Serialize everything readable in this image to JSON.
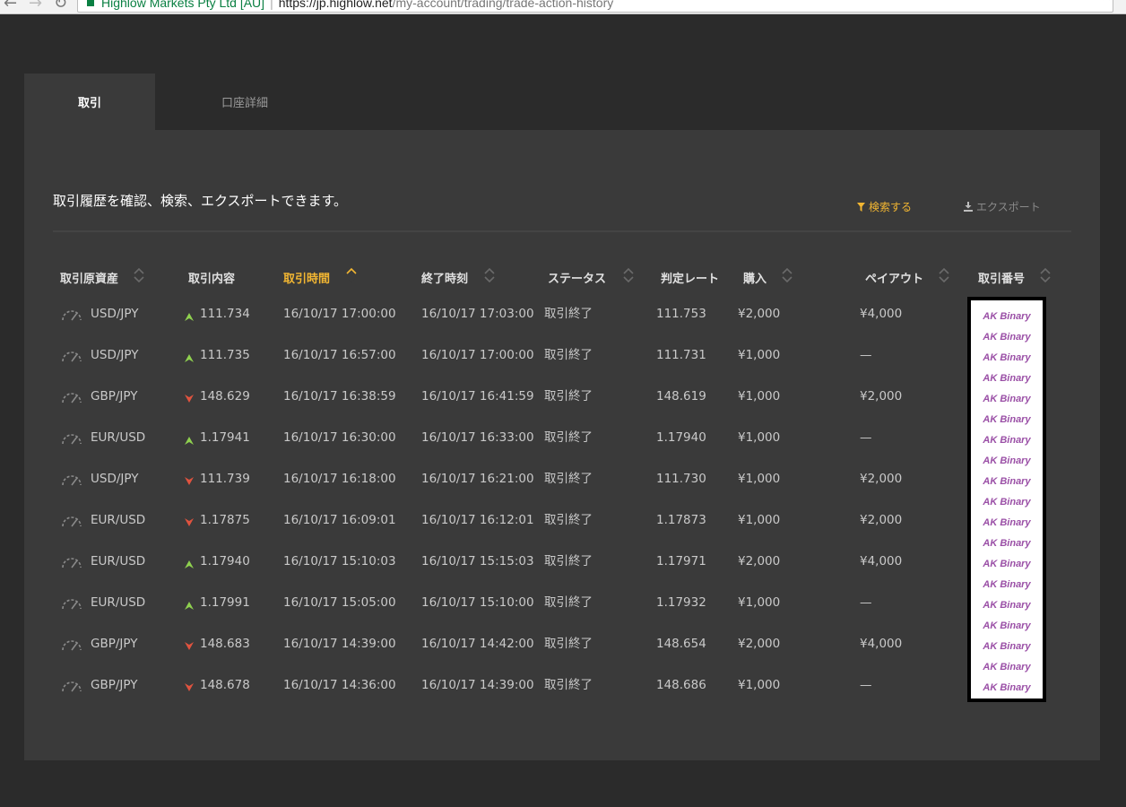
{
  "browser": {
    "site_name": "Highlow Markets Pty Ltd [AU]",
    "url_host": "https://jp.highlow.net",
    "url_path": "/my-account/trading/trade-action-history"
  },
  "tabs": [
    {
      "label": "取引",
      "active": true
    },
    {
      "label": "口座詳細",
      "active": false
    }
  ],
  "panel": {
    "description": "取引履歴を確認、検索、エクスポートできます。",
    "search_label": "検索する",
    "export_label": "エクスポート"
  },
  "table": {
    "columns": [
      "取引原資産",
      "取引内容",
      "取引時間",
      "終了時刻",
      "ステータス",
      "判定レート",
      "購入",
      "ペイアウト",
      "取引番号"
    ],
    "sorted_column": "取引時間",
    "rows": [
      {
        "asset": "USD/JPY",
        "direction": "up",
        "strike": "111.734",
        "start": "16/10/17 17:00:00",
        "end": "16/10/17 17:03:00",
        "status": "取引終了",
        "rate": "111.753",
        "amount": "¥2,000",
        "payout": "¥4,000"
      },
      {
        "asset": "USD/JPY",
        "direction": "up",
        "strike": "111.735",
        "start": "16/10/17 16:57:00",
        "end": "16/10/17 17:00:00",
        "status": "取引終了",
        "rate": "111.731",
        "amount": "¥1,000",
        "payout": "—"
      },
      {
        "asset": "GBP/JPY",
        "direction": "down",
        "strike": "148.629",
        "start": "16/10/17 16:38:59",
        "end": "16/10/17 16:41:59",
        "status": "取引終了",
        "rate": "148.619",
        "amount": "¥1,000",
        "payout": "¥2,000"
      },
      {
        "asset": "EUR/USD",
        "direction": "up",
        "strike": "1.17941",
        "start": "16/10/17 16:30:00",
        "end": "16/10/17 16:33:00",
        "status": "取引終了",
        "rate": "1.17940",
        "amount": "¥1,000",
        "payout": "—"
      },
      {
        "asset": "USD/JPY",
        "direction": "down",
        "strike": "111.739",
        "start": "16/10/17 16:18:00",
        "end": "16/10/17 16:21:00",
        "status": "取引終了",
        "rate": "111.730",
        "amount": "¥1,000",
        "payout": "¥2,000"
      },
      {
        "asset": "EUR/USD",
        "direction": "down",
        "strike": "1.17875",
        "start": "16/10/17 16:09:01",
        "end": "16/10/17 16:12:01",
        "status": "取引終了",
        "rate": "1.17873",
        "amount": "¥1,000",
        "payout": "¥2,000"
      },
      {
        "asset": "EUR/USD",
        "direction": "up",
        "strike": "1.17940",
        "start": "16/10/17 15:10:03",
        "end": "16/10/17 15:15:03",
        "status": "取引終了",
        "rate": "1.17971",
        "amount": "¥2,000",
        "payout": "¥4,000"
      },
      {
        "asset": "EUR/USD",
        "direction": "up",
        "strike": "1.17991",
        "start": "16/10/17 15:05:00",
        "end": "16/10/17 15:10:00",
        "status": "取引終了",
        "rate": "1.17932",
        "amount": "¥1,000",
        "payout": "—"
      },
      {
        "asset": "GBP/JPY",
        "direction": "down",
        "strike": "148.683",
        "start": "16/10/17 14:39:00",
        "end": "16/10/17 14:42:00",
        "status": "取引終了",
        "rate": "148.654",
        "amount": "¥2,000",
        "payout": "¥4,000"
      },
      {
        "asset": "GBP/JPY",
        "direction": "down",
        "strike": "148.678",
        "start": "16/10/17 14:36:00",
        "end": "16/10/17 14:39:00",
        "status": "取引終了",
        "rate": "148.686",
        "amount": "¥1,000",
        "payout": "—"
      }
    ]
  },
  "overlay": {
    "items": [
      "AK Binary",
      "AK Binary",
      "AK Binary",
      "AK Binary",
      "AK Binary",
      "AK Binary",
      "AK Binary",
      "AK Binary",
      "AK Binary",
      "AK Binary",
      "AK Binary",
      "AK Binary",
      "AK Binary",
      "AK Binary",
      "AK Binary",
      "AK Binary",
      "AK Binary",
      "AK Binary",
      "AK Binary"
    ]
  },
  "colors": {
    "accent": "#f2b632",
    "up": "#8fd14f",
    "down": "#e0533f",
    "overlay_text": "#9a4fa6"
  },
  "icons": {
    "asset": "gauge-icon",
    "up": "up-arrow-icon",
    "down": "down-arrow-icon",
    "search": "filter-icon",
    "export": "download-icon",
    "sort": "sort-icon"
  }
}
